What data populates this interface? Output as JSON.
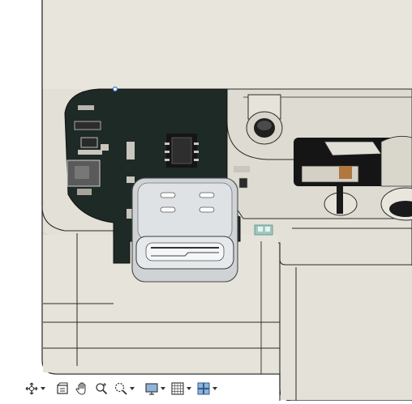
{
  "colors": {
    "background": "#ffffff",
    "shell": "#e2dfd6",
    "shell_light": "#f0eee8",
    "shell_shadow": "#cfcbbf",
    "pcb": "#1e2a25",
    "edge": "#2b2b2b",
    "usb_port": "#d8dbde",
    "accent_tab": "#9ec8c0"
  },
  "toolbar": {
    "items": [
      {
        "icon": "orbit-icon",
        "has_dropdown": true
      },
      {
        "icon": "look-at-icon",
        "has_dropdown": false
      },
      {
        "icon": "pan-icon",
        "has_dropdown": false
      },
      {
        "icon": "zoom-icon",
        "has_dropdown": false
      },
      {
        "icon": "fit-zoom-icon",
        "has_dropdown": true
      },
      {
        "icon": "display-settings-icon",
        "has_dropdown": true
      },
      {
        "icon": "grid-snaps-icon",
        "has_dropdown": true
      },
      {
        "icon": "viewports-icon",
        "has_dropdown": true
      }
    ]
  }
}
